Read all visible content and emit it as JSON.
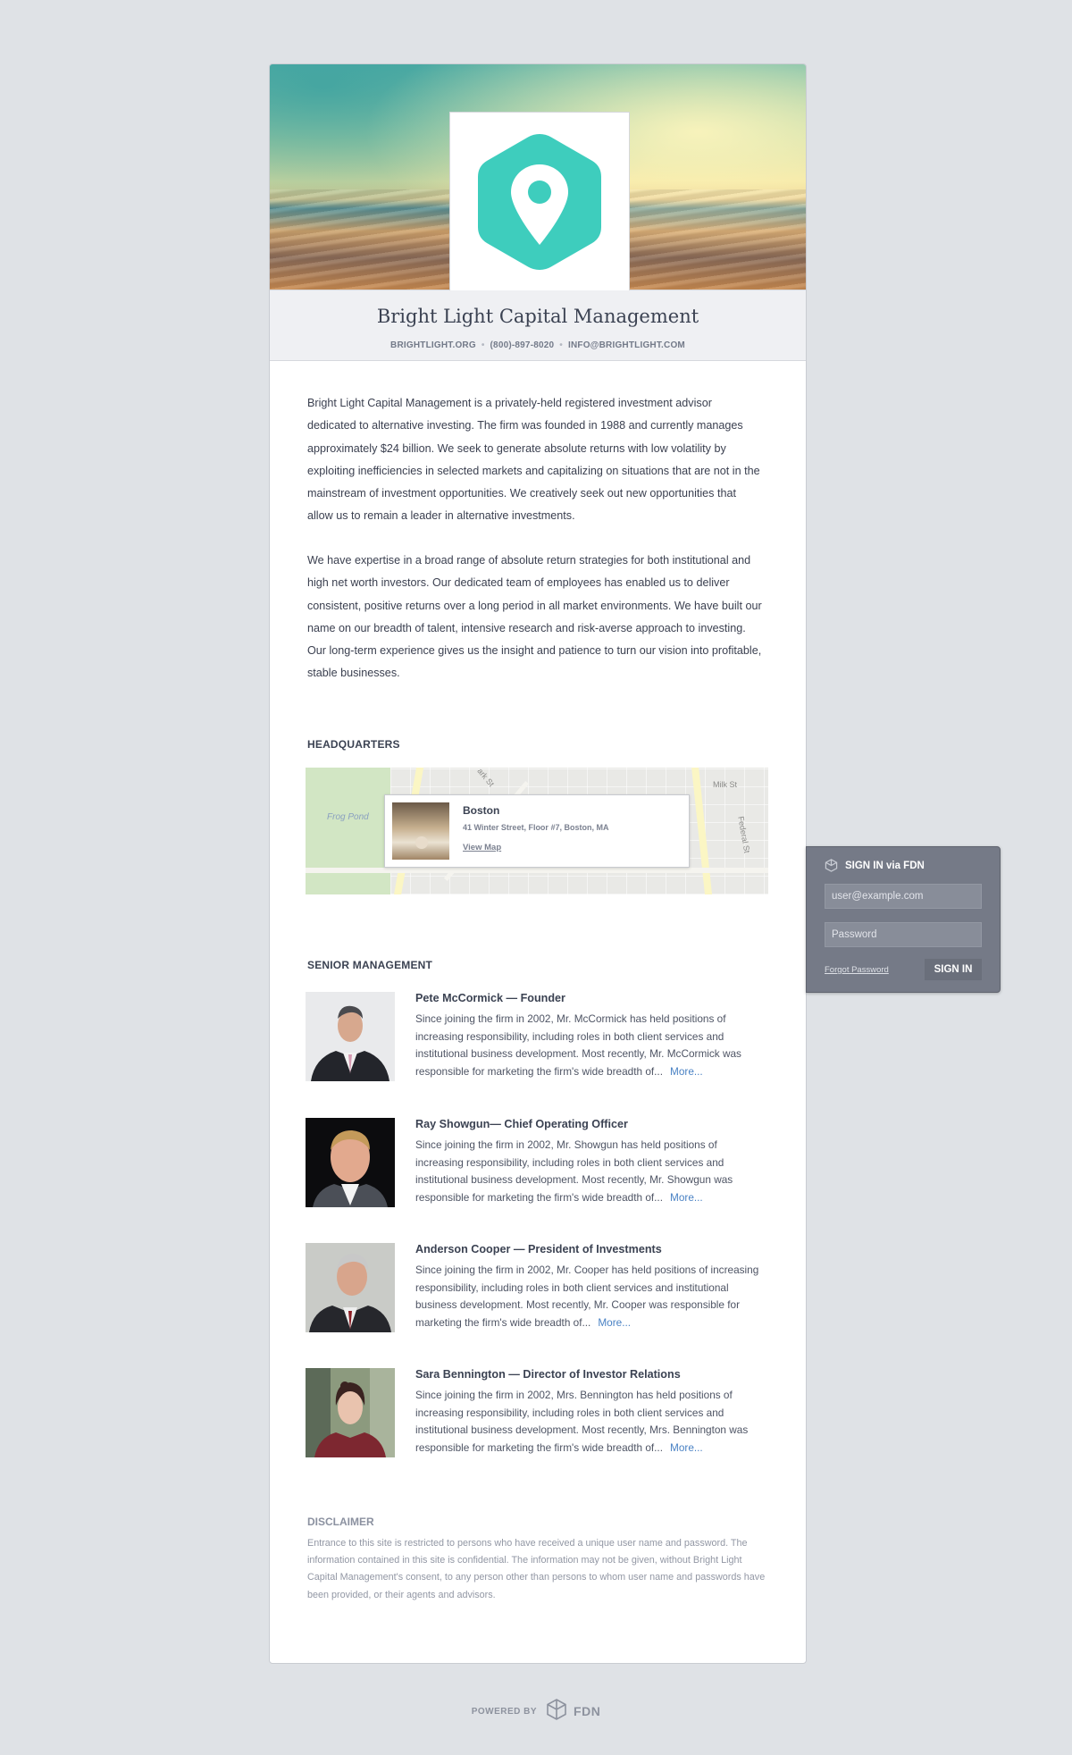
{
  "colors": {
    "accent_teal": "#3ecdbd",
    "link_blue": "#4a82c4",
    "signin_panel": "#757a87",
    "page_bg": "#dfe2e6"
  },
  "header": {
    "logo_icon": "map-pin-hexagon-icon",
    "company_name": "Bright Light Capital Management",
    "website": "BRIGHTLIGHT.ORG",
    "phone": "(800)-897-8020",
    "email": "INFO@BRIGHTLIGHT.COM"
  },
  "about": {
    "paragraph_1": "Bright Light Capital Management is a privately-held registered investment advisor dedicated to alternative investing. The firm was founded in 1988 and currently manages approximately $24 billion. We seek to generate absolute returns with low volatility by exploiting inefficiencies in selected markets and capitalizing on situations that are not in the mainstream of investment opportunities. We creatively seek out new opportunities that allow us to remain a leader in alternative investments.",
    "paragraph_2": "We have expertise in a broad range of absolute return strategies for both institutional and high net worth investors. Our dedicated team of employees has enabled us to deliver consistent, positive returns over a long period in all market environments. We have built our name on our breadth of talent, intensive research and risk-averse approach to investing. Our long-term experience gives us the insight and patience to turn our vision into profitable, stable businesses."
  },
  "headquarters": {
    "title": "HEADQUARTERS",
    "city": "Boston",
    "address": "41 Winter Street, Floor #7, Boston, MA",
    "map_link": "View Map",
    "map_labels": {
      "frog_pond": "Frog Pond",
      "milk_st": "Milk St",
      "federal_st": "Federal St",
      "park_st": "ark St"
    }
  },
  "management": {
    "title": "SENIOR MANAGEMENT",
    "more_label": "More...",
    "people": [
      {
        "name": "Pete McCormick — Founder",
        "bio": "Since joining the firm in 2002, Mr. McCormick has held positions of increasing responsibility, including roles in both client services and institutional business development. Most recently, Mr. McCormick was responsible for marketing the firm's wide breadth of..."
      },
      {
        "name": "Ray Showgun— Chief Operating Officer",
        "bio": "Since joining the firm in 2002, Mr. Showgun has held positions of increasing responsibility, including roles in both client services and institutional business development. Most recently, Mr. Showgun was responsible for marketing the firm's wide breadth of..."
      },
      {
        "name": "Anderson Cooper — President of Investments",
        "bio": "Since joining the firm in 2002, Mr. Cooper has held positions of increasing responsibility, including roles in both client services and institutional business development. Most recently, Mr. Cooper was responsible for marketing the firm's wide breadth of..."
      },
      {
        "name": "Sara Bennington — Director of Investor Relations",
        "bio": "Since joining the firm in 2002, Mrs. Bennington has held positions of increasing responsibility, including roles in both client services and institutional business development. Most recently, Mrs. Bennington was responsible for marketing the firm's wide breadth of..."
      }
    ]
  },
  "disclaimer": {
    "title": "DISCLAIMER",
    "text": "Entrance to this site is restricted to persons who have received a unique user name and password. The information contained in this site is confidential. The information may not be given, without Bright Light Capital Management's consent, to any person other than persons to whom user name and passwords have been provided, or their agents and advisors."
  },
  "signin": {
    "title": "SIGN IN via FDN",
    "email_placeholder": "user@example.com",
    "password_placeholder": "Password",
    "forgot_label": "Forgot Password",
    "button_label": "SIGN IN"
  },
  "footer": {
    "powered_label": "POWERED BY",
    "brand": "FDN"
  }
}
